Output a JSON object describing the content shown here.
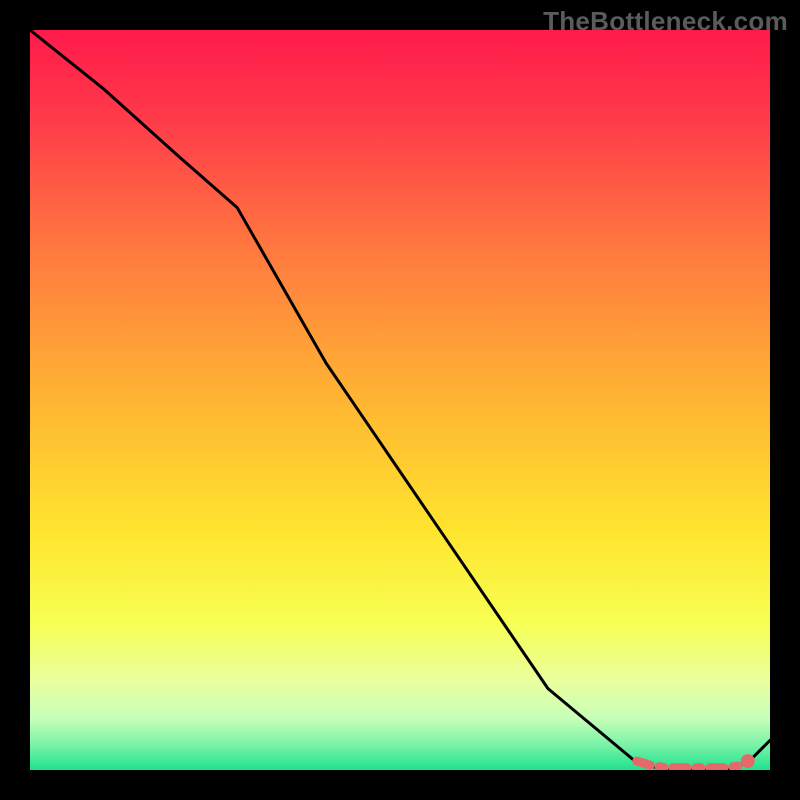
{
  "watermark": "TheBottleneck.com",
  "chart_data": {
    "type": "line",
    "title": "",
    "xlabel": "",
    "ylabel": "",
    "xlim": [
      0,
      100
    ],
    "ylim": [
      0,
      100
    ],
    "grid": false,
    "legend": false,
    "series": [
      {
        "name": "curve",
        "x": [
          0,
          10,
          20,
          28,
          40,
          55,
          70,
          82,
          86,
          90,
          94,
          97,
          100
        ],
        "y": [
          100,
          92,
          83,
          76,
          55,
          33,
          11,
          1,
          0,
          0,
          0,
          1,
          4
        ],
        "style": "solid",
        "color": "#000000"
      },
      {
        "name": "optimal-band",
        "x": [
          82,
          84,
          86,
          88,
          90,
          92,
          94,
          96,
          97
        ],
        "y": [
          1.2,
          0.6,
          0.3,
          0.3,
          0.3,
          0.3,
          0.3,
          0.6,
          1.2
        ],
        "style": "dashed",
        "color": "#e46a6a"
      }
    ],
    "markers": [
      {
        "name": "optimal-point",
        "x": 97,
        "y": 1.2,
        "color": "#e46a6a"
      }
    ],
    "background_gradient": {
      "stops": [
        {
          "pos": 0.0,
          "color": "#ff1a4b"
        },
        {
          "pos": 0.12,
          "color": "#ff3a4a"
        },
        {
          "pos": 0.3,
          "color": "#ff7a3f"
        },
        {
          "pos": 0.5,
          "color": "#ffb533"
        },
        {
          "pos": 0.68,
          "color": "#ffe52e"
        },
        {
          "pos": 0.8,
          "color": "#f7ff53"
        },
        {
          "pos": 0.88,
          "color": "#eaff9e"
        },
        {
          "pos": 0.93,
          "color": "#c7ffb8"
        },
        {
          "pos": 0.965,
          "color": "#7cf3a8"
        },
        {
          "pos": 1.0,
          "color": "#1fe28c"
        }
      ]
    }
  }
}
